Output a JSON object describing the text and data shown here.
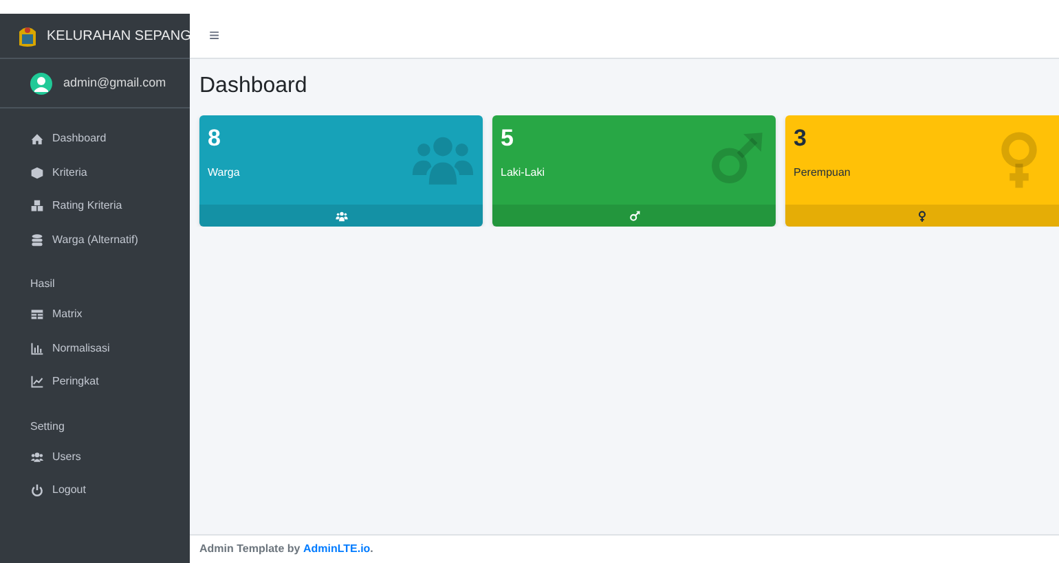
{
  "brand": {
    "title": "KELURAHAN SEPANG"
  },
  "user": {
    "email": "admin@gmail.com"
  },
  "sidebar": {
    "items": [
      {
        "kind": "item",
        "label": "Dashboard",
        "selected": false
      },
      {
        "kind": "item",
        "label": "Kriteria",
        "selected": false
      },
      {
        "kind": "item",
        "label": "Rating Kriteria",
        "selected": false
      },
      {
        "kind": "item",
        "label": "Warga (Alternatif)",
        "selected": false
      },
      {
        "kind": "header",
        "label": "Hasil"
      },
      {
        "kind": "item",
        "label": "Matrix",
        "selected": false
      },
      {
        "kind": "item",
        "label": "Normalisasi",
        "selected": false
      },
      {
        "kind": "item",
        "label": "Peringkat",
        "selected": false
      },
      {
        "kind": "header",
        "label": "Setting"
      },
      {
        "kind": "item",
        "label": "Users",
        "selected": false
      },
      {
        "kind": "item",
        "label": "Logout",
        "selected": false
      }
    ]
  },
  "navbar": {
    "menu": "≡"
  },
  "page": {
    "title": "Dashboard"
  },
  "cards": [
    {
      "value": "8",
      "label": "Warga",
      "color": "#17a2b8"
    },
    {
      "value": "5",
      "label": "Laki-Laki",
      "color": "#28a745"
    },
    {
      "value": "3",
      "label": "Perempuan",
      "color": "#ffc107"
    }
  ],
  "footer": {
    "text": "Admin Template by",
    "link": "AdminLTE.io",
    "end": "."
  }
}
